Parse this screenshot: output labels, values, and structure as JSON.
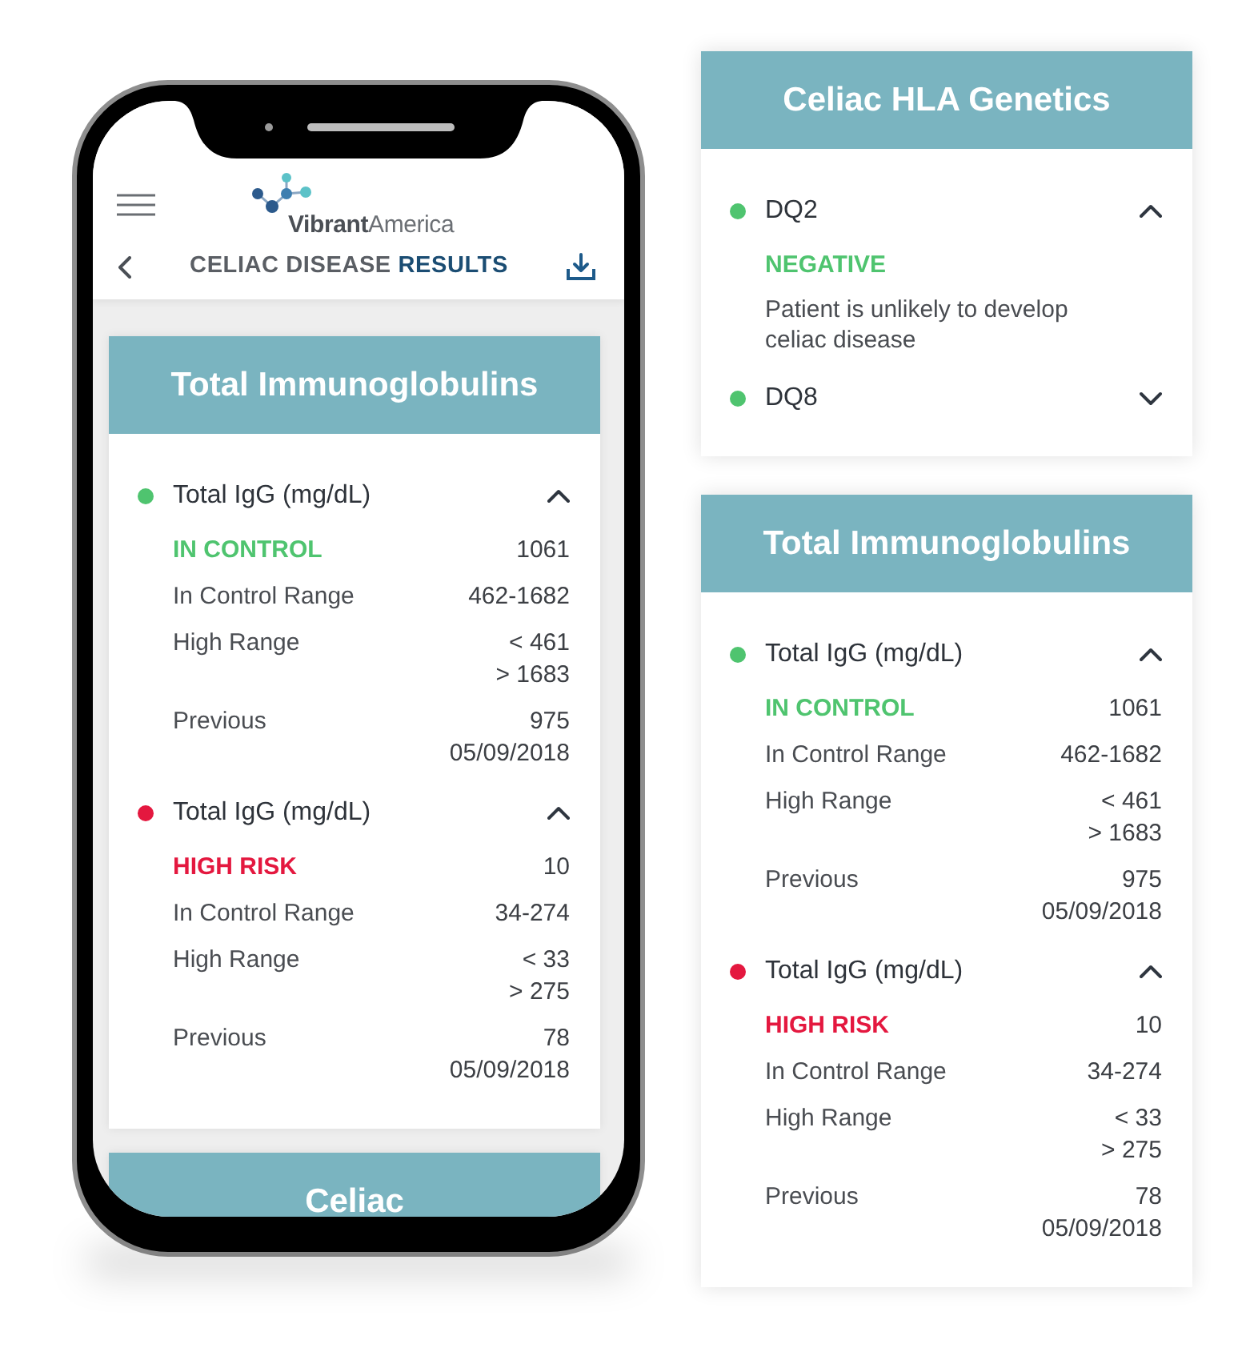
{
  "phone": {
    "header": {
      "brand": "**Vibrant**America",
      "title": "CELIAC DISEASE **RESULTS**"
    },
    "cards": [
      {
        "title": "Total Immunoglobulins",
        "tests": [
          {
            "name": "Total IgG (mg/dL)",
            "color": "#4fc46f",
            "expanded": true,
            "status": "IN CONTROL",
            "value": "1061",
            "rows": [
              {
                "label": "In Control Range",
                "values": [
                  "462-1682"
                ]
              },
              {
                "label": "High Range",
                "values": [
                  "< 461",
                  "> 1683"
                ]
              },
              {
                "label": "Previous",
                "values": [
                  "975",
                  "05/09/2018"
                ]
              }
            ]
          },
          {
            "name": "Total IgG (mg/dL)",
            "color": "#e4183f",
            "expanded": true,
            "status": "HIGH RISK",
            "value": "10",
            "rows": [
              {
                "label": "In Control Range",
                "values": [
                  "34-274"
                ]
              },
              {
                "label": "High Range",
                "values": [
                  "< 33",
                  "> 275"
                ]
              },
              {
                "label": "Previous",
                "values": [
                  "78",
                  "05/09/2018"
                ]
              }
            ]
          }
        ]
      },
      {
        "title": "Celiac"
      }
    ]
  },
  "side_cards": [
    {
      "title": "Celiac HLA Genetics",
      "tests": [
        {
          "name": "DQ2",
          "color": "#4fc46f",
          "expanded": true,
          "status": "NEGATIVE",
          "description": "Patient is unlikely to develop celiac disease"
        },
        {
          "name": "DQ8",
          "color": "#4fc46f",
          "expanded": false
        }
      ]
    },
    {
      "title": "Total Immunoglobulins",
      "tests": [
        {
          "name": "Total IgG (mg/dL)",
          "color": "#4fc46f",
          "expanded": true,
          "status": "IN CONTROL",
          "value": "1061",
          "rows": [
            {
              "label": "In Control Range",
              "values": [
                "462-1682"
              ]
            },
            {
              "label": "High Range",
              "values": [
                "< 461",
                "> 1683"
              ]
            },
            {
              "label": "Previous",
              "values": [
                "975",
                "05/09/2018"
              ]
            }
          ]
        },
        {
          "name": "Total IgG (mg/dL)",
          "color": "#e4183f",
          "expanded": true,
          "status": "HIGH RISK",
          "value": "10",
          "rows": [
            {
              "label": "In Control Range",
              "values": [
                "34-274"
              ]
            },
            {
              "label": "High Range",
              "values": [
                "< 33",
                "> 275"
              ]
            },
            {
              "label": "Previous",
              "values": [
                "78",
                "05/09/2018"
              ]
            }
          ]
        }
      ]
    }
  ]
}
